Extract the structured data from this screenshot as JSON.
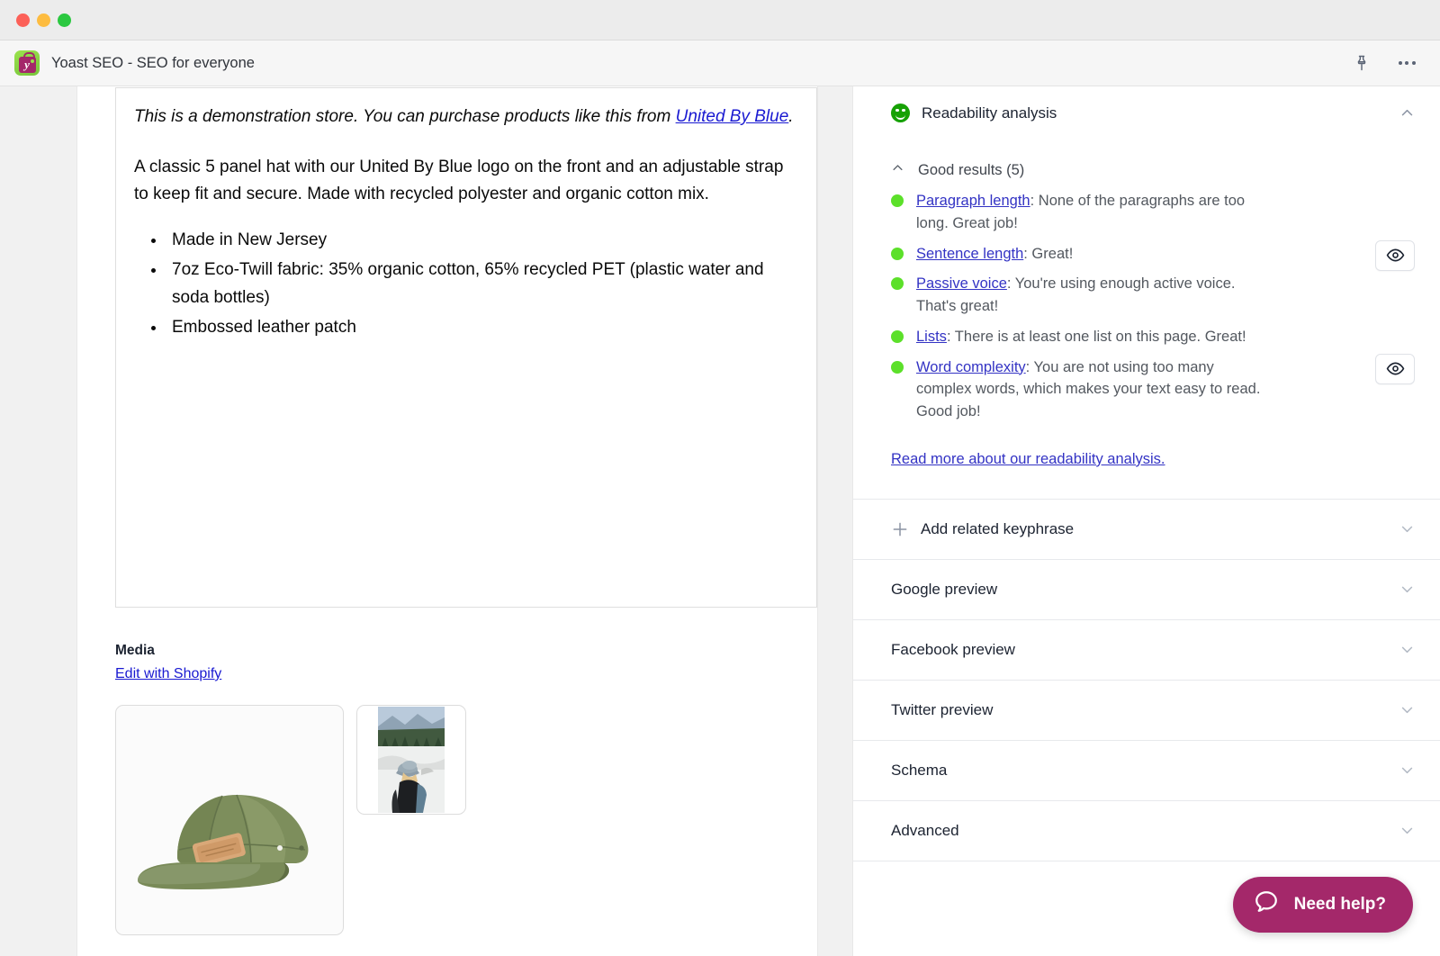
{
  "window": {
    "traffic_lights": [
      "close",
      "minimize",
      "maximize"
    ]
  },
  "appbar": {
    "title": "Yoast SEO - SEO for everyone",
    "logo_letter": "y",
    "icons": [
      "pin-icon",
      "more-options-icon"
    ]
  },
  "editor": {
    "demo_notice_prefix": "This is a demonstration store. You can purchase products like this from ",
    "demo_notice_link": "United By Blue",
    "demo_notice_suffix": ".",
    "description": "A classic 5 panel hat with our United By Blue logo on the front and an adjustable strap to keep fit and secure. Made with recycled polyester and organic cotton mix.",
    "features": [
      "Made in New Jersey",
      "7oz Eco-Twill fabric: 35% organic cotton, 65% recycled PET (plastic water and soda bottles)",
      "Embossed leather patch"
    ],
    "media": {
      "label": "Media",
      "edit_link": "Edit with Shopify",
      "thumbs": [
        {
          "alt": "olive green 5 panel hat product photo"
        },
        {
          "alt": "person wearing hat in snowy mountain landscape"
        }
      ]
    }
  },
  "sidebar": {
    "readability": {
      "title": "Readability analysis",
      "icon": "green-smiley-icon",
      "collapse_state": "expanded",
      "good_results_label": "Good results (5)",
      "results": [
        {
          "link": "Paragraph length",
          "text": ": None of the paragraphs are too long. Great job!",
          "status": "good",
          "has_eye_button": false
        },
        {
          "link": "Sentence length",
          "text": ": Great!",
          "status": "good",
          "has_eye_button": true
        },
        {
          "link": "Passive voice",
          "text": ": You're using enough active voice. That's great!",
          "status": "good",
          "has_eye_button": false
        },
        {
          "link": "Lists",
          "text": ": There is at least one list on this page. Great!",
          "status": "good",
          "has_eye_button": false
        },
        {
          "link": "Word complexity",
          "text": ": You are not using too many complex words, which makes your text easy to read. Good job!",
          "status": "good",
          "has_eye_button": true
        }
      ],
      "read_more": "Read more about our readability analysis."
    },
    "sections": [
      {
        "label": "Add related keyphrase",
        "has_plus": true
      },
      {
        "label": "Google preview",
        "has_plus": false
      },
      {
        "label": "Facebook preview",
        "has_plus": false
      },
      {
        "label": "Twitter preview",
        "has_plus": false
      },
      {
        "label": "Schema",
        "has_plus": false
      },
      {
        "label": "Advanced",
        "has_plus": false
      }
    ]
  },
  "support": {
    "need_help_label": "Need help?",
    "icon": "chat-bubble-icon"
  },
  "colors": {
    "brand_magenta": "#a4286a",
    "good_green": "#5ce02a",
    "smiley_green": "#16a104",
    "link_blue": "#3333c4",
    "editor_link": "#1919d1"
  }
}
